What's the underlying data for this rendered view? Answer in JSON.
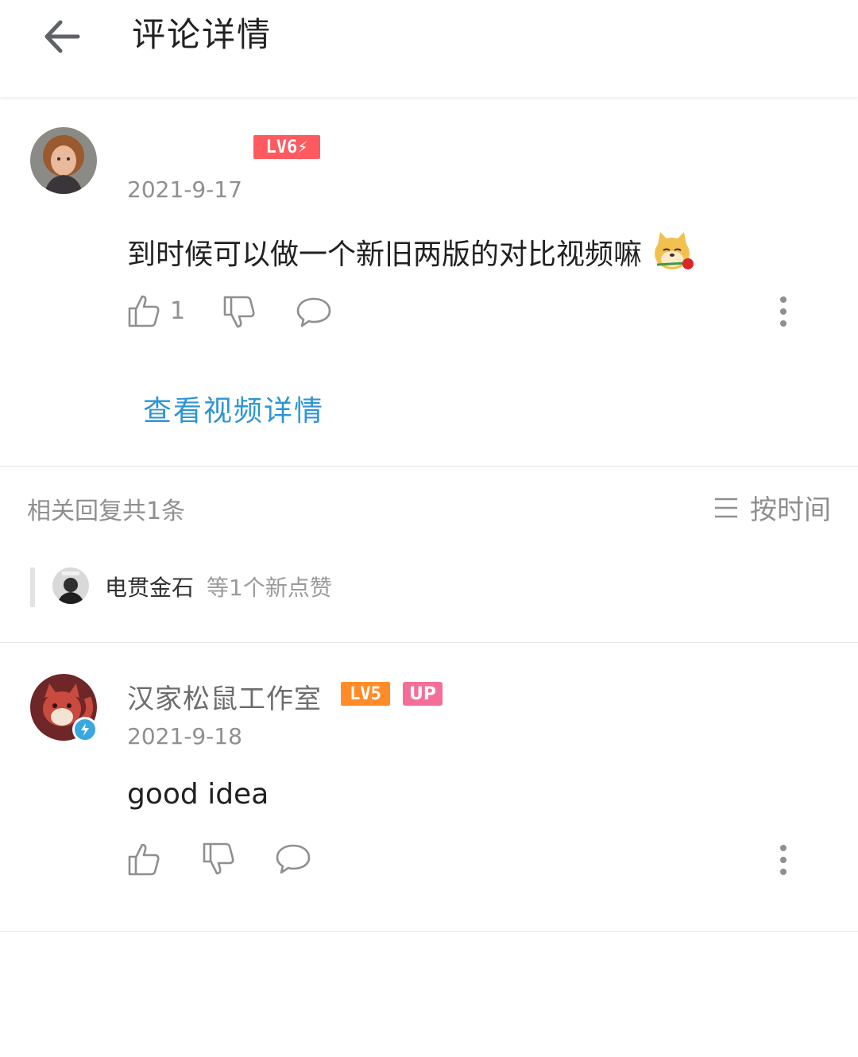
{
  "header": {
    "title": "评论详情",
    "back_icon": "arrow-left-icon"
  },
  "main_comment": {
    "username": "",
    "level": "LV6",
    "level_color": "#ff5a5f",
    "date": "2021-9-17",
    "text": "到时候可以做一个新旧两版的对比视频嘛",
    "emoji": "doge-rose-emoji",
    "likes": "1",
    "view_video_label": "查看视频详情"
  },
  "replies_section": {
    "count_label": "相关回复共1条",
    "sort_label": "按时间",
    "new_likes": {
      "user": "电贯金石",
      "suffix": "等1个新点赞"
    }
  },
  "reply": {
    "username": "汉家松鼠工作室",
    "level": "LV5",
    "level_color": "#ff8c29",
    "up_label": "UP",
    "up_color": "#f56e98",
    "date": "2021-9-18",
    "text": "good idea"
  },
  "colors": {
    "link": "#2d95d3",
    "muted": "#8f8f8f",
    "divider": "#e6e6e6"
  }
}
